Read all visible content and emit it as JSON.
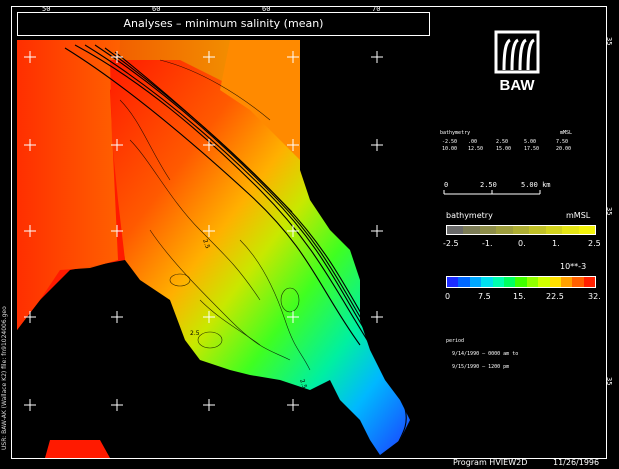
{
  "title": "Analyses – minimum salinity (mean)",
  "logo_text": "BAW",
  "top_ticks": [
    "50",
    "60",
    "60",
    "70"
  ],
  "right_ticks": [
    "35",
    "35",
    "35"
  ],
  "bathymetry_small": {
    "header_left": "bathymetry",
    "header_right": "mMSL",
    "row1": [
      "-2.50",
      ".00",
      "2.50",
      "5.00",
      "7.50"
    ],
    "row2": [
      "10.00",
      "12.50",
      "15.00",
      "17.50",
      "20.00"
    ]
  },
  "scale": {
    "labels": [
      "0",
      "2.50",
      "5.00 km"
    ]
  },
  "bathymetry_bar": {
    "title": "bathymetry",
    "unit": "mMSL",
    "tick_labels": [
      "-2.5",
      "-1.",
      "0.",
      "1.",
      "2.5"
    ],
    "colors": [
      "#6b6b6b",
      "#7c7c56",
      "#8c8c48",
      "#9d9d3c",
      "#adad32",
      "#c0c026",
      "#d2d21c",
      "#e4e414",
      "#f2f20a"
    ]
  },
  "salinity_bar": {
    "title": "10**-3",
    "tick_labels": [
      "0",
      "7.5",
      "15.",
      "22.5",
      "32."
    ],
    "colors": [
      "#1c2cff",
      "#0068ff",
      "#00a8ff",
      "#00e0f0",
      "#00ffb0",
      "#00ff60",
      "#40ff00",
      "#90ff00",
      "#d0ff00",
      "#ffe000",
      "#ffa000",
      "#ff6000",
      "#ff2000"
    ]
  },
  "period": {
    "label": "period",
    "line1": "9/14/1990 – 0000 am to",
    "line2": "9/15/1990 – 1200 pm"
  },
  "left_caption": "USR: BAW-AK (Wallace K2)   file: fn91024006.geo",
  "footer": {
    "program": "Program  HVIEW2D",
    "date": "11/26/1996"
  },
  "map_labels": [
    "2.5",
    "2.5",
    "2.5"
  ]
}
